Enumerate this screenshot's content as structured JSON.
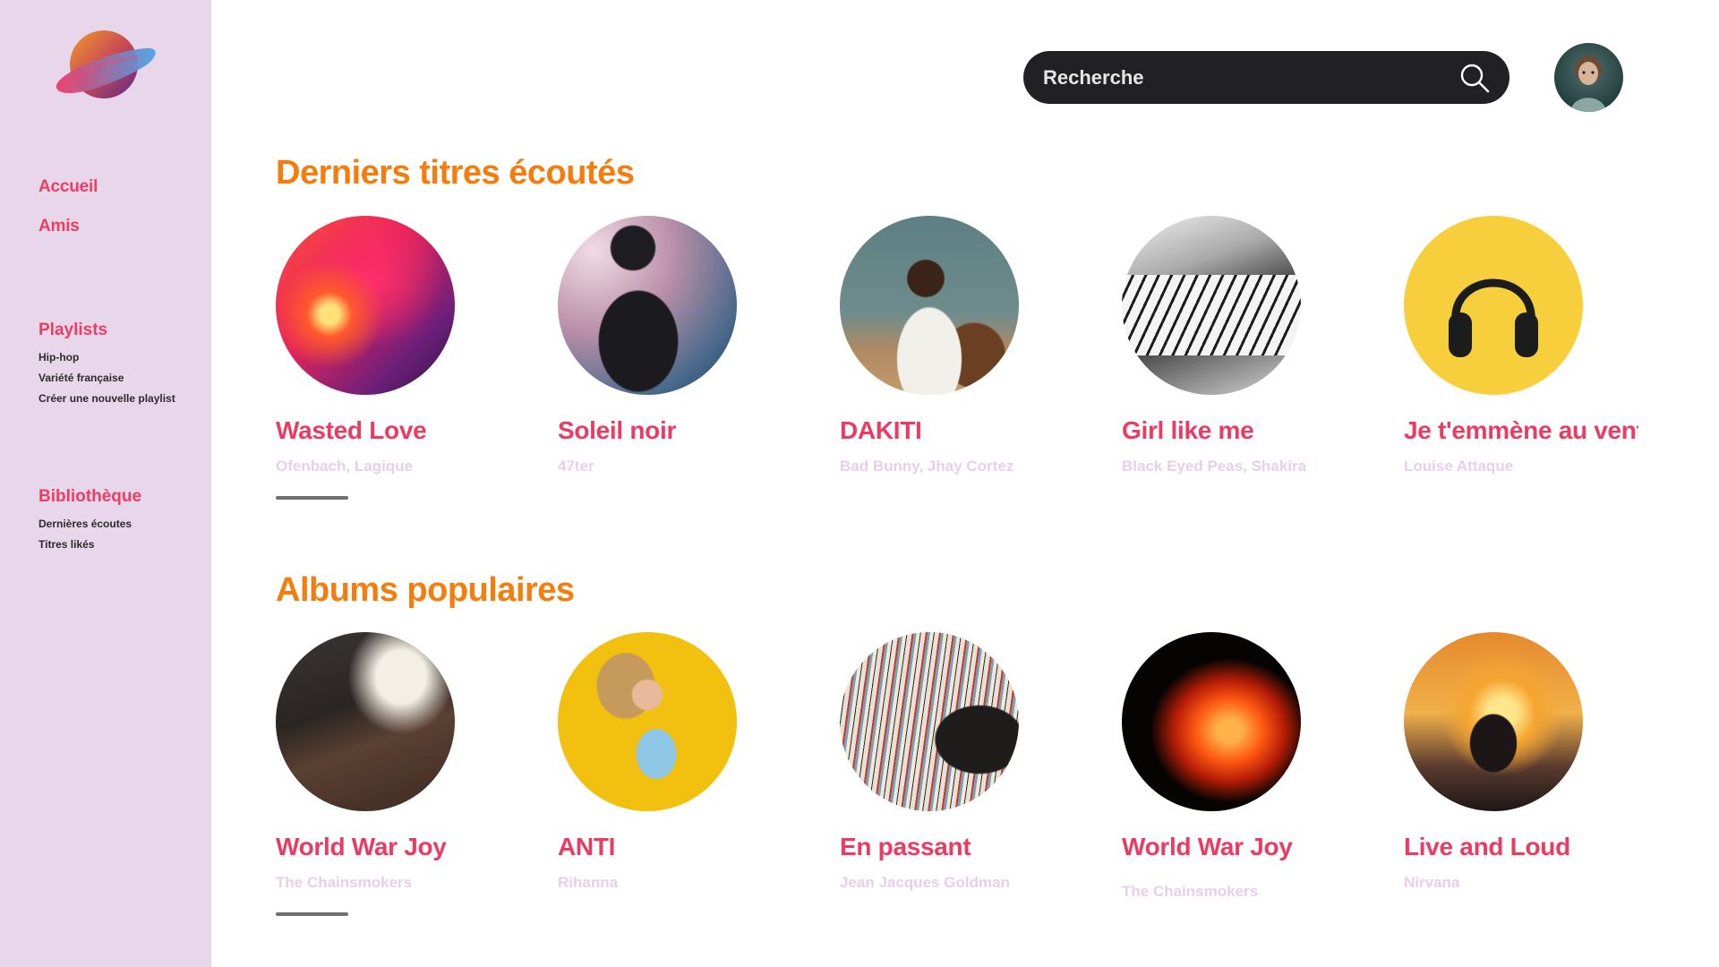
{
  "sidebar": {
    "main_nav": [
      "Accueil",
      "Amis"
    ],
    "playlists": {
      "title": "Playlists",
      "items": [
        "Hip-hop",
        "Variété française",
        "Créer une nouvelle playlist"
      ]
    },
    "library": {
      "title": "Bibliothèque",
      "items": [
        "Dernières écoutes",
        "Titres likés"
      ]
    }
  },
  "header": {
    "search_placeholder": "Recherche"
  },
  "recent": {
    "title": "Derniers titres écoutés",
    "cards": [
      {
        "title": "Wasted Love",
        "subtitle": "Ofenbach, Lagique"
      },
      {
        "title": "Soleil noir",
        "subtitle": "47ter"
      },
      {
        "title": "DAKITI",
        "subtitle": "Bad Bunny, Jhay Cortez"
      },
      {
        "title": "Girl like me",
        "subtitle": "Black Eyed Peas, Shakira"
      },
      {
        "title": "Je t'emmène au vent",
        "subtitle": "Louise Attaque"
      }
    ]
  },
  "albums": {
    "title": "Albums populaires",
    "cards": [
      {
        "title": "World War Joy",
        "subtitle": "The Chainsmokers"
      },
      {
        "title": "ANTI",
        "subtitle": "Rihanna"
      },
      {
        "title": "En passant",
        "subtitle": "Jean Jacques Goldman"
      },
      {
        "title": "World War Joy",
        "subtitle": "The Chainsmokers"
      },
      {
        "title": "Live and Loud",
        "subtitle": "Nirvana"
      }
    ]
  },
  "colors": {
    "accent": "#ED3D62",
    "section_title": "#F47D0E",
    "sidebar_bg": "#E8D6EA",
    "subtitle": "#E6CFE8"
  }
}
